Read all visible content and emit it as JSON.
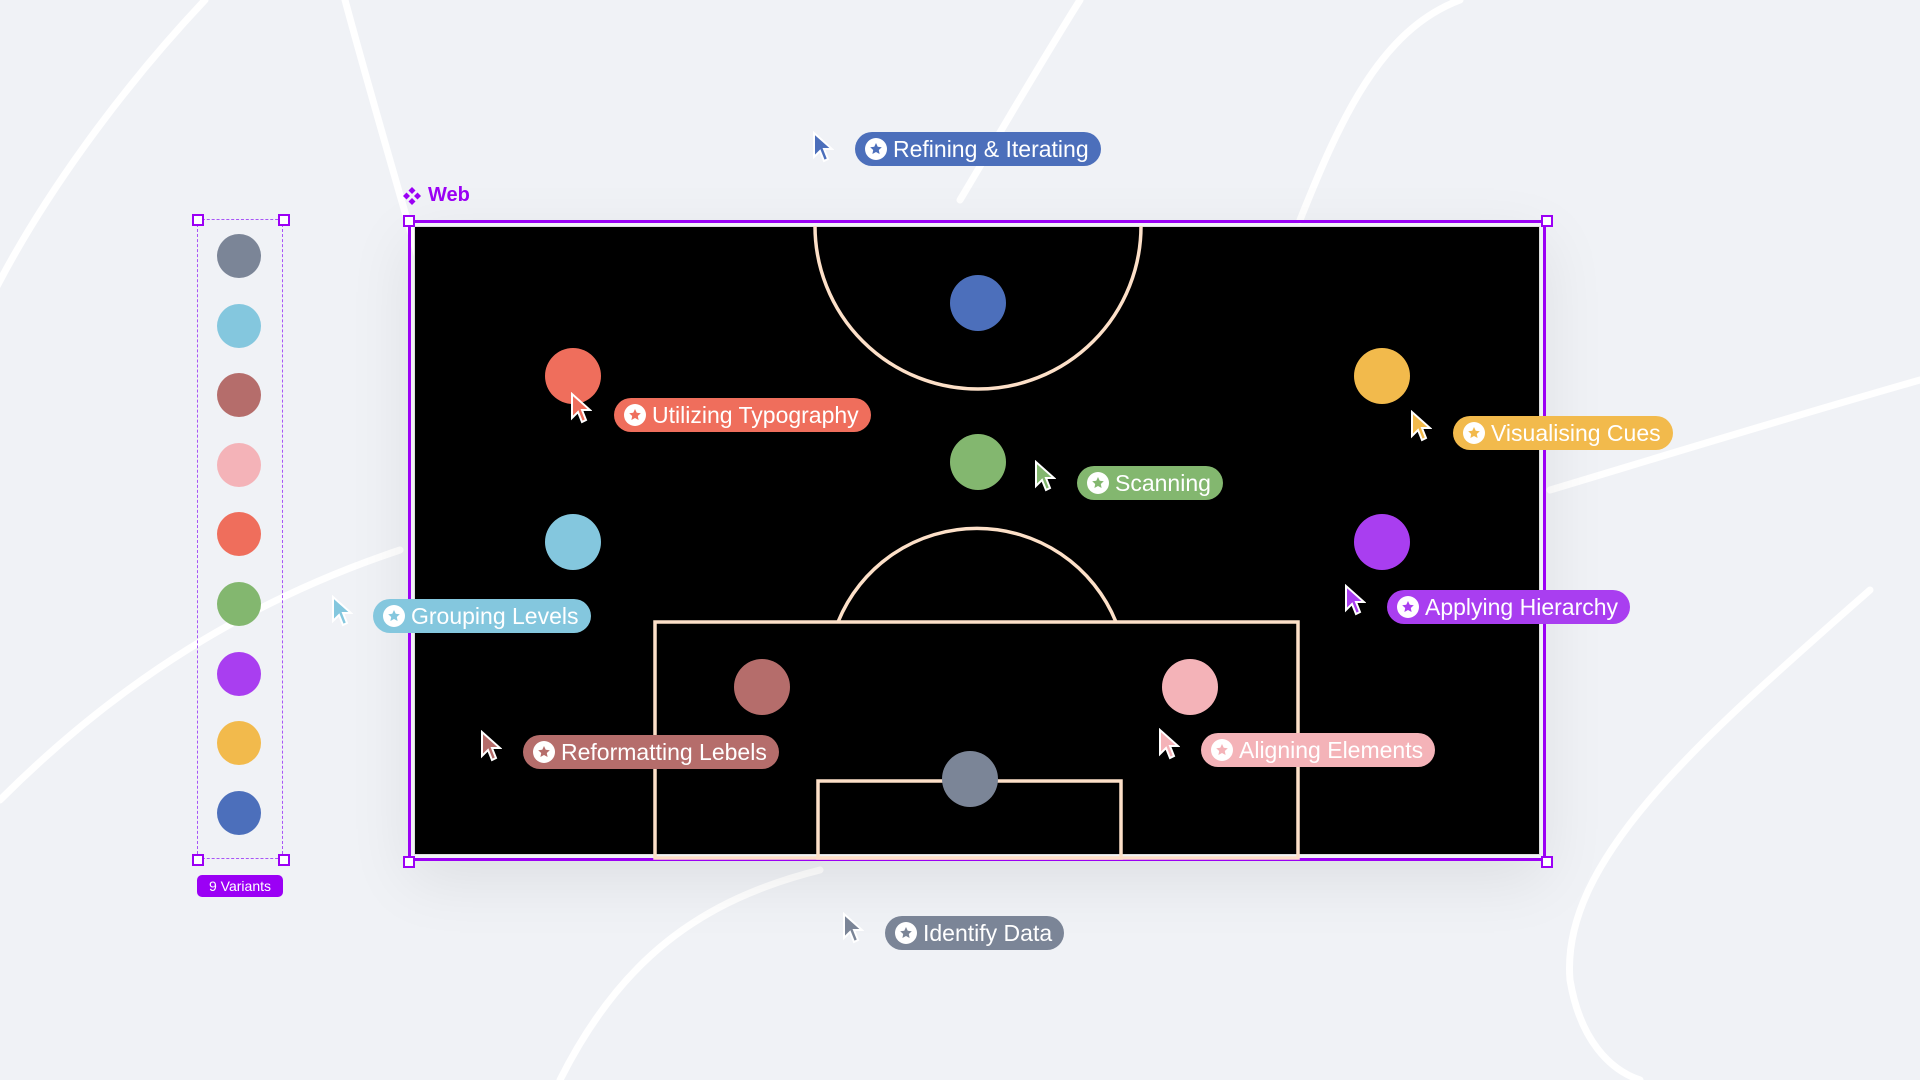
{
  "frame": {
    "label": "Web",
    "icon": "component-icon",
    "accent": "#9b00f5"
  },
  "variants": {
    "badge": "9 Variants",
    "colors": [
      "#7b8597",
      "#84c7de",
      "#b56d6b",
      "#f4b3b8",
      "#ef6e5c",
      "#83b76f",
      "#a93ef0",
      "#f2ba4c",
      "#4c6fbb"
    ]
  },
  "players": [
    {
      "name": "Refining & Iterating",
      "color": "#4c6fbb"
    },
    {
      "name": "Utilizing Typography",
      "color": "#ef6e5c"
    },
    {
      "name": "Visualising Cues",
      "color": "#f2ba4c"
    },
    {
      "name": "Scanning",
      "color": "#83b76f"
    },
    {
      "name": "Grouping Levels",
      "color": "#84c7de"
    },
    {
      "name": "Applying Hierarchy",
      "color": "#a93ef0"
    },
    {
      "name": "Reformatting Lebels",
      "color": "#b56d6b"
    },
    {
      "name": "Aligning Elements",
      "color": "#f4b3b8"
    },
    {
      "name": "Identify Data",
      "color": "#7b8597"
    }
  ],
  "pitch": {
    "background": "#000000",
    "line_color": "#fde0c8"
  }
}
